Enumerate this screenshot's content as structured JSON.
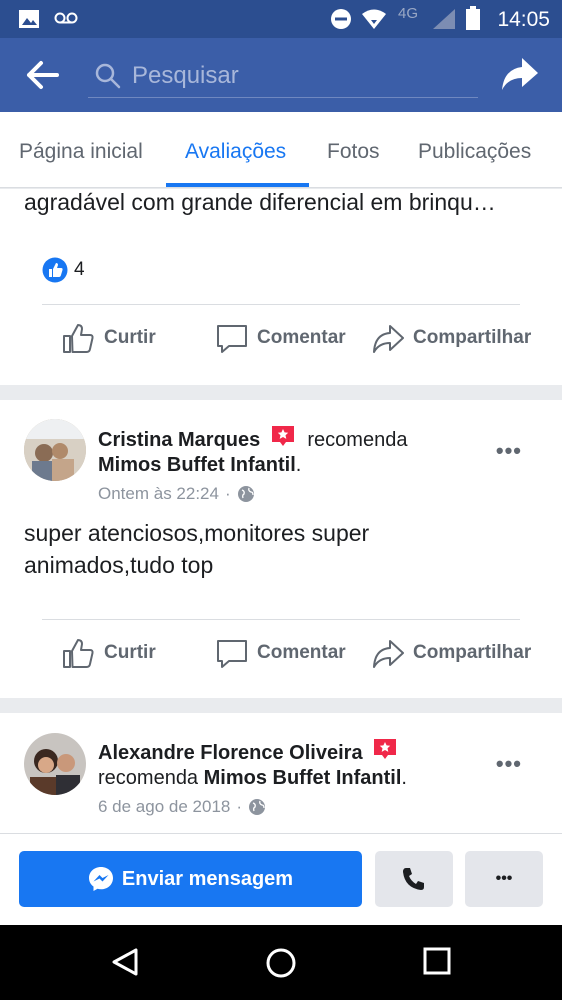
{
  "status_bar": {
    "time": "14:05",
    "network": "4G"
  },
  "search": {
    "placeholder": "Pesquisar"
  },
  "tabs": [
    {
      "label": "Página inicial"
    },
    {
      "label": "Avaliações"
    },
    {
      "label": "Fotos"
    },
    {
      "label": "Publicações"
    }
  ],
  "review1": {
    "text": "agradável com grande diferencial em brinqu…",
    "like_count": "4"
  },
  "actions": {
    "like": "Curtir",
    "comment": "Comentar",
    "share": "Compartilhar"
  },
  "review2": {
    "author": "Cristina Marques",
    "recommends": "recomenda",
    "page": "Mimos Buffet Infantil",
    "timestamp": "Ontem às 22:24",
    "text_line1": "super atenciosos,monitores super",
    "text_line2": "animados,tudo top"
  },
  "review3": {
    "author": "Alexandre Florence Oliveira",
    "recommends": "recomenda",
    "page": "Mimos Buffet Infantil",
    "timestamp": "6 de ago de 2018"
  },
  "bottom": {
    "message_button": "Enviar mensagem",
    "more": "•••"
  },
  "colors": {
    "brand": "#3b5ea8",
    "accent": "#1877f2",
    "recommend": "#f02849"
  }
}
